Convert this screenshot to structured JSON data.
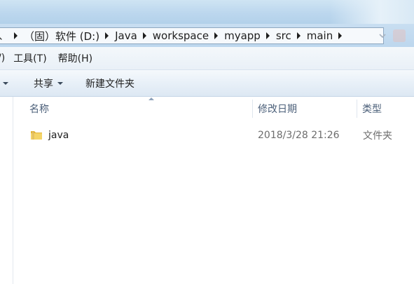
{
  "address_bar": {
    "leading_fragment": "、",
    "crumbs": [
      {
        "label": "（固）软件 (D:)"
      },
      {
        "label": "Java"
      },
      {
        "label": "workspace"
      },
      {
        "label": "myapp"
      },
      {
        "label": "src"
      },
      {
        "label": "main"
      }
    ]
  },
  "menu": {
    "partial_view": "/)",
    "tools": "工具(T)",
    "help": "帮助(H)"
  },
  "toolbar": {
    "share": "共享",
    "new_folder": "新建文件夹"
  },
  "columns": {
    "name": "名称",
    "modified": "修改日期",
    "type": "类型"
  },
  "files": [
    {
      "name": "java",
      "modified": "2018/3/28 21:26",
      "type": "文件夹",
      "icon": "folder-icon"
    }
  ],
  "colors": {
    "frame": "#bcd7ee",
    "header_text": "#4c607a",
    "folder": "#e8c04a"
  }
}
